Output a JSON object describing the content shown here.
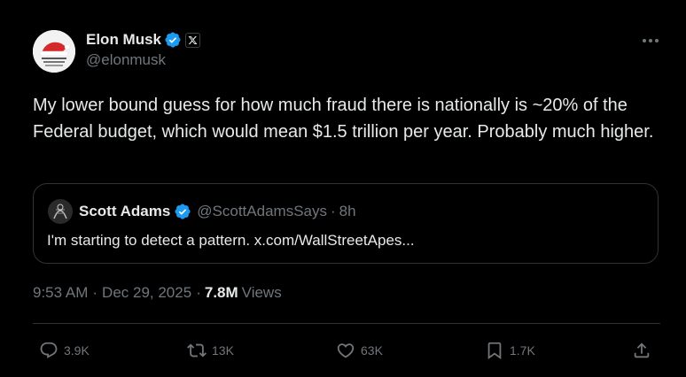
{
  "author": {
    "display_name": "Elon Musk",
    "handle": "@elonmusk",
    "verified_color": "#1d9bf0"
  },
  "tweet": {
    "text": "My lower bound guess for how much fraud there is nationally is ~20% of the Federal budget, which would mean $1.5 trillion per year. Probably much higher."
  },
  "quote": {
    "display_name": "Scott Adams",
    "handle": "@ScottAdamsSays",
    "separator": "·",
    "time": "8h",
    "text": "I'm starting to detect a pattern. x.com/WallStreetApes..."
  },
  "meta": {
    "time": "9:53 AM",
    "separator": "·",
    "date": "Dec 29, 2025",
    "views_count": "7.8M",
    "views_label": "Views"
  },
  "actions": {
    "replies": "3.9K",
    "reposts": "13K",
    "likes": "63K",
    "bookmarks": "1.7K"
  },
  "icons": {
    "more": "more-horizontal-icon",
    "reply": "reply-icon",
    "repost": "repost-icon",
    "like": "heart-icon",
    "bookmark": "bookmark-icon",
    "share": "share-icon"
  }
}
